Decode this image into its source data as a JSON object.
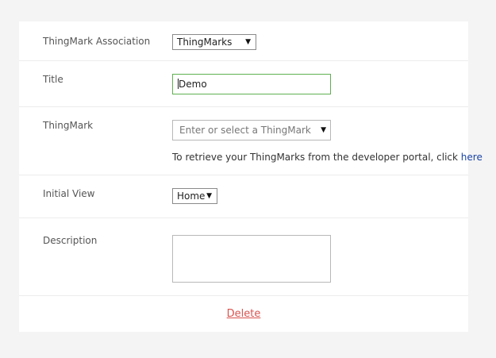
{
  "form": {
    "association": {
      "label": "ThingMark Association",
      "selected": "ThingMarks"
    },
    "title": {
      "label": "Title",
      "value": "Demo"
    },
    "thingmark": {
      "label": "ThingMark",
      "placeholder": "Enter or select a ThingMark",
      "hint_text": "To retrieve your ThingMarks from the developer portal, click ",
      "hint_link": "here"
    },
    "initial_view": {
      "label": "Initial View",
      "selected": "Home"
    },
    "description": {
      "label": "Description",
      "value": ""
    },
    "delete_label": "Delete"
  },
  "icons": {
    "dropdown_arrow": "▼"
  },
  "colors": {
    "focus_border": "#5fb150",
    "link": "#1a44a6",
    "delete": "#d9534f"
  }
}
